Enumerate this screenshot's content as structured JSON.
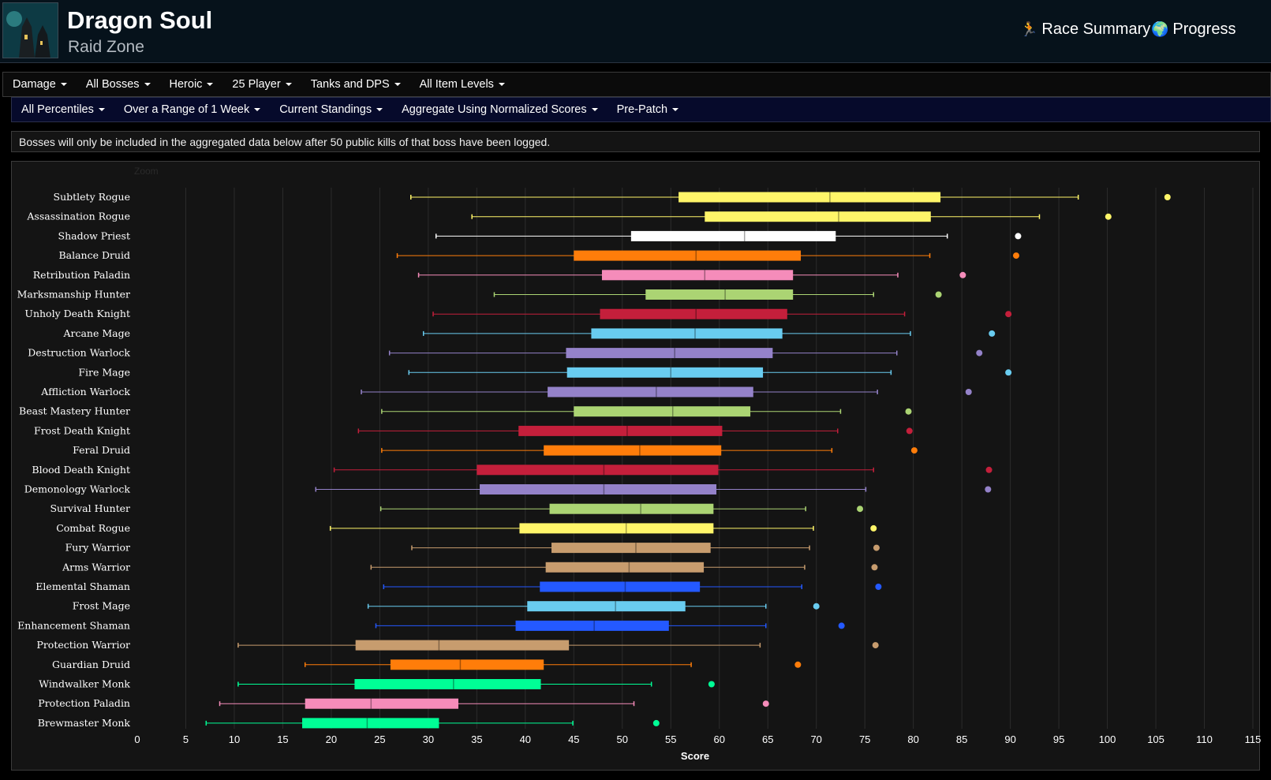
{
  "header": {
    "title": "Dragon Soul",
    "subtitle": "Raid Zone",
    "race_summary_label": "Race Summary",
    "progress_label": "Progress"
  },
  "filters_row1": [
    "Damage",
    "All Bosses",
    "Heroic",
    "25 Player",
    "Tanks and DPS",
    "All Item Levels"
  ],
  "filters_row2": [
    "All Percentiles",
    "Over a Range of 1 Week",
    "Current Standings",
    "Aggregate Using Normalized Scores",
    "Pre-Patch"
  ],
  "notice": "Bosses will only be included in the aggregated data below after 50 public kills of that boss have been logged.",
  "zoom_label": "Zoom",
  "chart_data": {
    "type": "boxplot",
    "orientation": "horizontal",
    "xlabel": "Score",
    "xlim": [
      0,
      115
    ],
    "xticks": [
      0,
      5,
      10,
      15,
      20,
      25,
      30,
      35,
      40,
      45,
      50,
      55,
      60,
      65,
      70,
      75,
      80,
      85,
      90,
      95,
      100,
      105,
      110,
      115
    ],
    "grid": true,
    "series": [
      {
        "name": "Subtlety Rogue",
        "color": "#fff569",
        "min": 28.2,
        "q1": 55.8,
        "median": 71.4,
        "q3": 82.8,
        "max": 97.0,
        "outlier": 106.2
      },
      {
        "name": "Assassination Rogue",
        "color": "#fff569",
        "min": 34.5,
        "q1": 58.5,
        "median": 72.3,
        "q3": 81.8,
        "max": 93.0,
        "outlier": 100.1
      },
      {
        "name": "Shadow Priest",
        "color": "#ffffff",
        "min": 30.8,
        "q1": 50.9,
        "median": 62.6,
        "q3": 72.0,
        "max": 83.5,
        "outlier": 90.8
      },
      {
        "name": "Balance Druid",
        "color": "#ff7d0a",
        "min": 26.8,
        "q1": 45.0,
        "median": 57.6,
        "q3": 68.4,
        "max": 81.7,
        "outlier": 90.6
      },
      {
        "name": "Retribution Paladin",
        "color": "#f58cba",
        "min": 29.0,
        "q1": 47.9,
        "median": 58.5,
        "q3": 67.6,
        "max": 78.4,
        "outlier": 85.1
      },
      {
        "name": "Marksmanship Hunter",
        "color": "#abd473",
        "min": 36.8,
        "q1": 52.4,
        "median": 60.6,
        "q3": 67.6,
        "max": 75.9,
        "outlier": 82.6
      },
      {
        "name": "Unholy Death Knight",
        "color": "#c41f3b",
        "min": 30.5,
        "q1": 47.7,
        "median": 57.6,
        "q3": 67.0,
        "max": 79.1,
        "outlier": 89.8
      },
      {
        "name": "Arcane Mage",
        "color": "#69ccf0",
        "min": 29.5,
        "q1": 46.8,
        "median": 57.5,
        "q3": 66.5,
        "max": 79.7,
        "outlier": 88.1
      },
      {
        "name": "Destruction Warlock",
        "color": "#9482c9",
        "min": 26.0,
        "q1": 44.2,
        "median": 55.4,
        "q3": 65.5,
        "max": 78.3,
        "outlier": 86.8
      },
      {
        "name": "Fire Mage",
        "color": "#69ccf0",
        "min": 28.0,
        "q1": 44.3,
        "median": 55.0,
        "q3": 64.5,
        "max": 77.7,
        "outlier": 89.8
      },
      {
        "name": "Affliction Warlock",
        "color": "#9482c9",
        "min": 23.1,
        "q1": 42.3,
        "median": 53.5,
        "q3": 63.5,
        "max": 76.3,
        "outlier": 85.7
      },
      {
        "name": "Beast Mastery Hunter",
        "color": "#abd473",
        "min": 25.2,
        "q1": 45.0,
        "median": 55.2,
        "q3": 63.2,
        "max": 72.5,
        "outlier": 79.5
      },
      {
        "name": "Frost Death Knight",
        "color": "#c41f3b",
        "min": 22.8,
        "q1": 39.3,
        "median": 50.5,
        "q3": 60.3,
        "max": 72.2,
        "outlier": 79.6
      },
      {
        "name": "Feral Druid",
        "color": "#ff7d0a",
        "min": 25.2,
        "q1": 41.9,
        "median": 51.8,
        "q3": 60.2,
        "max": 71.6,
        "outlier": 80.1
      },
      {
        "name": "Blood Death Knight",
        "color": "#c41f3b",
        "min": 20.3,
        "q1": 35.0,
        "median": 48.1,
        "q3": 59.9,
        "max": 75.9,
        "outlier": 87.8
      },
      {
        "name": "Demonology Warlock",
        "color": "#9482c9",
        "min": 18.4,
        "q1": 35.3,
        "median": 48.1,
        "q3": 59.7,
        "max": 75.1,
        "outlier": 87.7
      },
      {
        "name": "Survival Hunter",
        "color": "#abd473",
        "min": 25.1,
        "q1": 42.5,
        "median": 51.9,
        "q3": 59.4,
        "max": 68.9,
        "outlier": 74.5
      },
      {
        "name": "Combat Rogue",
        "color": "#fff569",
        "min": 19.9,
        "q1": 39.4,
        "median": 50.4,
        "q3": 59.4,
        "max": 69.7,
        "outlier": 75.9
      },
      {
        "name": "Fury Warrior",
        "color": "#c79c6e",
        "min": 28.3,
        "q1": 42.7,
        "median": 51.4,
        "q3": 59.1,
        "max": 69.3,
        "outlier": 76.2
      },
      {
        "name": "Arms Warrior",
        "color": "#c79c6e",
        "min": 24.1,
        "q1": 42.1,
        "median": 50.7,
        "q3": 58.4,
        "max": 68.8,
        "outlier": 76.0
      },
      {
        "name": "Elemental Shaman",
        "color": "#2459ff",
        "min": 25.4,
        "q1": 41.5,
        "median": 50.3,
        "q3": 58.0,
        "max": 68.5,
        "outlier": 76.4
      },
      {
        "name": "Frost Mage",
        "color": "#69ccf0",
        "min": 23.8,
        "q1": 40.2,
        "median": 49.3,
        "q3": 56.5,
        "max": 64.8,
        "outlier": 70.0
      },
      {
        "name": "Enhancement Shaman",
        "color": "#2459ff",
        "min": 24.6,
        "q1": 39.0,
        "median": 47.1,
        "q3": 54.8,
        "max": 64.8,
        "outlier": 72.6
      },
      {
        "name": "Protection Warrior",
        "color": "#c79c6e",
        "min": 10.4,
        "q1": 22.5,
        "median": 31.1,
        "q3": 44.5,
        "max": 64.2,
        "outlier": 76.1
      },
      {
        "name": "Guardian Druid",
        "color": "#ff7d0a",
        "min": 17.3,
        "q1": 26.1,
        "median": 33.3,
        "q3": 41.9,
        "max": 57.1,
        "outlier": 68.1
      },
      {
        "name": "Windwalker Monk",
        "color": "#00ff96",
        "min": 10.4,
        "q1": 22.4,
        "median": 32.6,
        "q3": 41.6,
        "max": 53.0,
        "outlier": 59.2
      },
      {
        "name": "Protection Paladin",
        "color": "#f58cba",
        "min": 8.5,
        "q1": 17.3,
        "median": 24.1,
        "q3": 33.1,
        "max": 51.2,
        "outlier": 64.8
      },
      {
        "name": "Brewmaster Monk",
        "color": "#00ff96",
        "min": 7.1,
        "q1": 17.0,
        "median": 23.7,
        "q3": 31.1,
        "max": 44.9,
        "outlier": 53.5
      }
    ]
  }
}
